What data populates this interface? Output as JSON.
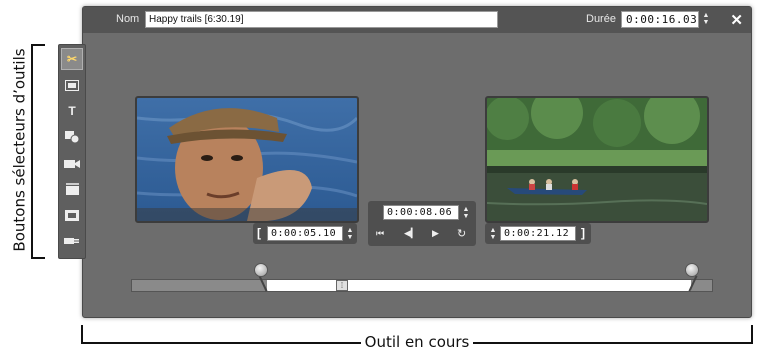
{
  "annotations": {
    "tool_buttons_label": "Boutons sélecteurs d’outils",
    "current_tool_label": "Outil en cours"
  },
  "window": {
    "name_label": "Nom",
    "name_value": "Happy trails [6:30.19]",
    "duration_label": "Durée",
    "duration_value": "0:00:16.03",
    "close_icon": "close-icon"
  },
  "toolstrip": {
    "tools": [
      {
        "icon": "scissors-icon",
        "active": true
      },
      {
        "icon": "image-icon",
        "active": false
      },
      {
        "icon": "title-text-icon",
        "active": false
      },
      {
        "icon": "overlay-icon",
        "active": false
      },
      {
        "icon": "camera-icon",
        "active": false
      },
      {
        "icon": "clapper-icon",
        "active": false
      },
      {
        "icon": "film-icon",
        "active": false
      },
      {
        "icon": "plug-icon",
        "active": false
      }
    ]
  },
  "trim": {
    "in_point": "0:00:05.10",
    "current_position": "0:00:08.06",
    "out_point": "0:00:21.12",
    "transport_icons": [
      "skip-to-start-icon",
      "step-back-icon",
      "play-icon",
      "loop-icon"
    ],
    "in_fraction": 0.235,
    "out_fraction": 0.97,
    "playhead_fraction": 0.36
  },
  "colors": {
    "window_bg": "#6d6d6d",
    "titlebar_bg": "#545454",
    "active_tool_accent": "#ffd86b"
  }
}
